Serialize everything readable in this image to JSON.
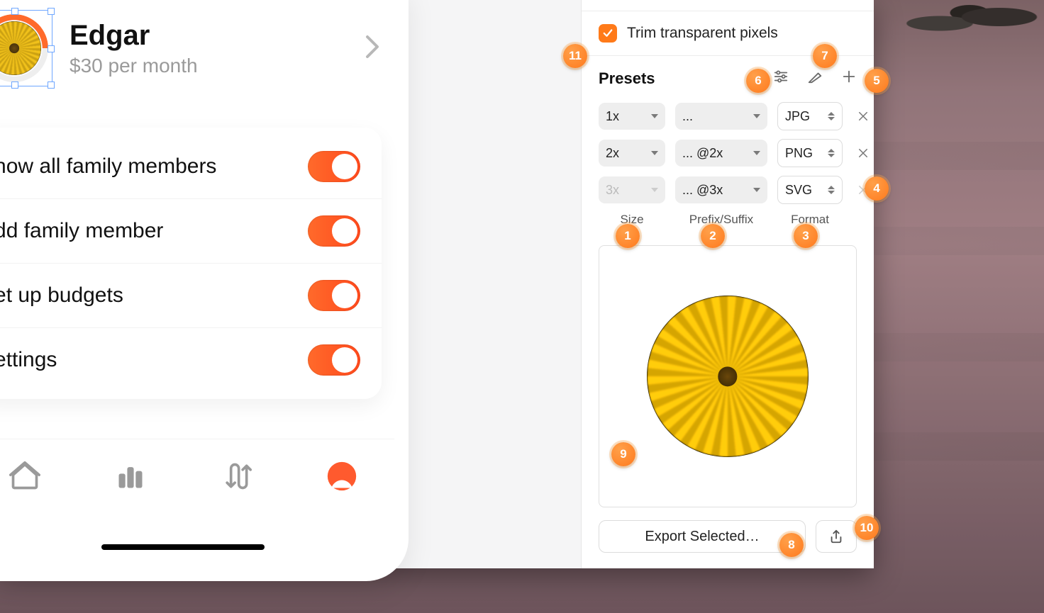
{
  "profile": {
    "name": "Edgar",
    "price": "$30 per month"
  },
  "settings": [
    {
      "label": "Show all family members",
      "on": true
    },
    {
      "label": "Add family member",
      "on": true
    },
    {
      "label": "Set up budgets",
      "on": true
    },
    {
      "label": "Settings",
      "on": true
    }
  ],
  "inspector": {
    "trim_label": "Trim transparent pixels",
    "trim_checked": true,
    "presets_title": "Presets",
    "labels": {
      "size": "Size",
      "prefix_suffix": "Prefix/Suffix",
      "format": "Format"
    },
    "rows": [
      {
        "size": "1x",
        "suffix": "...",
        "format": "JPG",
        "enabled": true
      },
      {
        "size": "2x",
        "suffix": "... @2x",
        "format": "PNG",
        "enabled": true
      },
      {
        "size": "3x",
        "suffix": "... @3x",
        "format": "SVG",
        "enabled": false
      }
    ],
    "export_label": "Export Selected…"
  },
  "callouts": {
    "1": "1",
    "2": "2",
    "3": "3",
    "4": "4",
    "5": "5",
    "6": "6",
    "7": "7",
    "8": "8",
    "9": "9",
    "10": "10",
    "11": "11"
  }
}
